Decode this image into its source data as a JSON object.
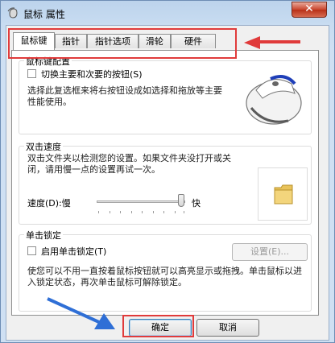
{
  "window": {
    "title": "鼠标 属性",
    "close_label": "✕"
  },
  "tabs": [
    "鼠标键",
    "指针",
    "指针选项",
    "滑轮",
    "硬件"
  ],
  "button_config": {
    "legend": "鼠标键配置",
    "switch_label": "切换主要和次要的按钮(S)",
    "description": "选择此复选框来将右按钮设成如选择和拖放等主要性能使用。"
  },
  "double_click": {
    "legend": "双击速度",
    "description": "双击文件夹以检测您的设置。如果文件夹没打开或关闭，请用慢一点的设置再试一次。",
    "speed_label": "速度(D):慢",
    "fast_label": "快",
    "speed_value": 0.95
  },
  "click_lock": {
    "legend": "单击锁定",
    "enable_label": "启用单击锁定(T)",
    "settings_button": "设置(E)...",
    "description": "使您可以不用一直按着鼠标按钮就可以高亮显示或拖拽。单击鼠标以进入锁定状态，再次单击鼠标可解除锁定。"
  },
  "footer": {
    "ok_label": "确定",
    "cancel_label": "取消"
  },
  "colors": {
    "annotation_red": "#e03b3b",
    "annotation_arrow": "#2f6fd6"
  }
}
